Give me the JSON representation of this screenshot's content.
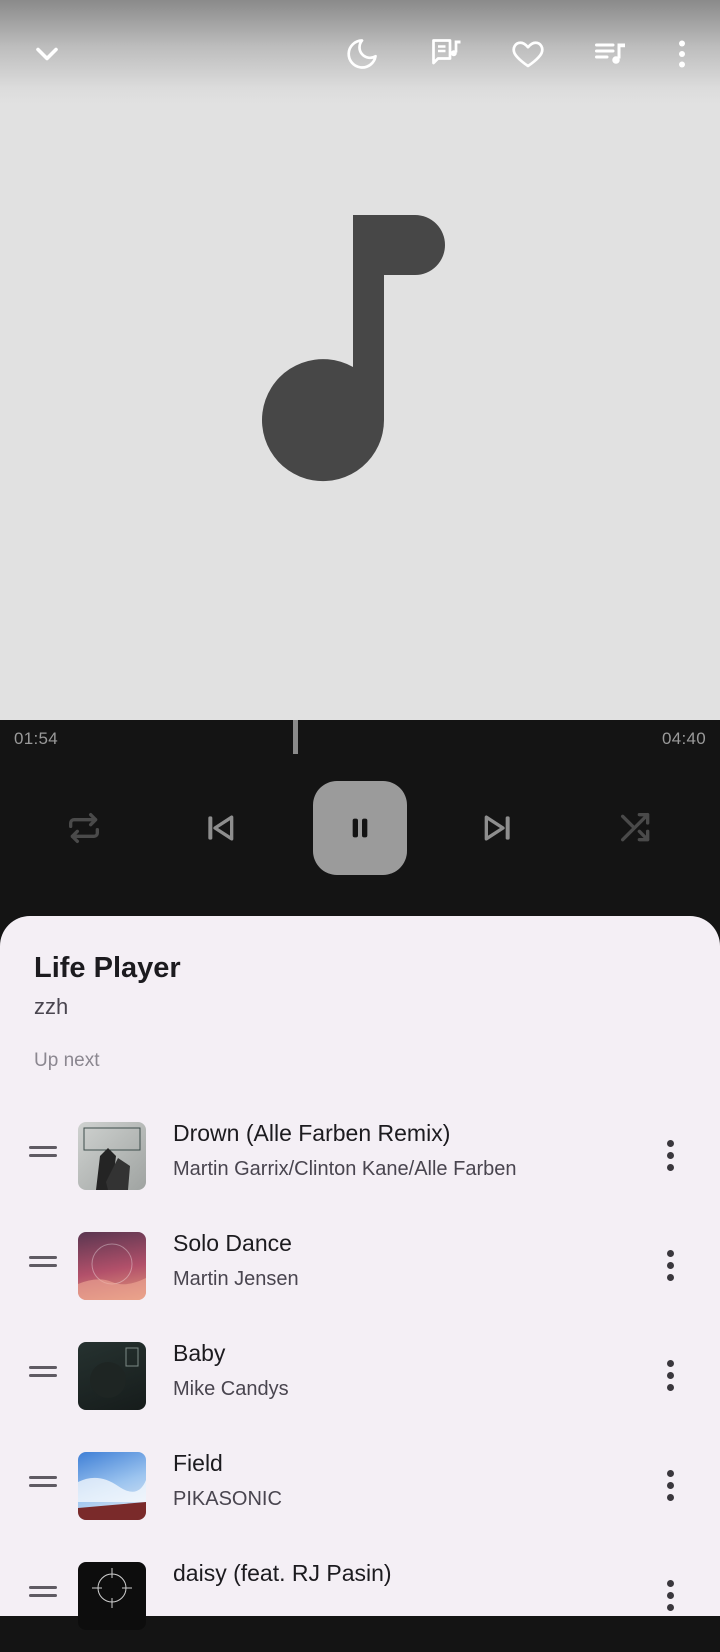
{
  "player": {
    "elapsed": "01:54",
    "duration": "04:40",
    "progress_fraction": 0.407,
    "state": "playing"
  },
  "toolbar": {
    "icons": [
      "chevron-down-icon",
      "moon-icon",
      "lyrics-icon",
      "heart-icon",
      "queue-music-icon",
      "more-vert-icon"
    ]
  },
  "playlist": {
    "title": "Life Player",
    "owner": "zzh",
    "section_label": "Up next",
    "items": [
      {
        "title": "Drown (Alle Farben Remix)",
        "artist": "Martin Garrix/Clinton Kane/Alle Farben"
      },
      {
        "title": "Solo Dance",
        "artist": "Martin Jensen"
      },
      {
        "title": "Baby",
        "artist": "Mike Candys"
      },
      {
        "title": "Field",
        "artist": "PIKASONIC"
      },
      {
        "title": "daisy (feat. RJ Pasin)",
        "artist": ""
      }
    ]
  },
  "colors": {
    "art_background": "#e1e1e1",
    "controls_background": "#141414",
    "play_button": "#9b9b9b",
    "sheet_background": "#f4eff5"
  }
}
